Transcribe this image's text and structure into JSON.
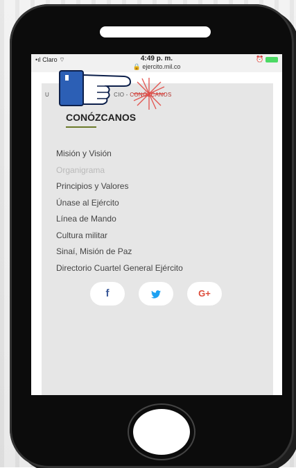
{
  "status_bar": {
    "carrier": "Claro",
    "time": "4:49 p. m.",
    "url": "ejercito.mil.co"
  },
  "breadcrumb": {
    "prefix": "U",
    "middle": "CIO",
    "separator": " - ",
    "current": "CONÓZCANOS"
  },
  "section": {
    "title": "CONÓZCANOS"
  },
  "menu": [
    {
      "label": "Misión y Visión",
      "active": true
    },
    {
      "label": "Organigrama",
      "active": false
    },
    {
      "label": "Principios y Valores",
      "active": true
    },
    {
      "label": "Únase al Ejército",
      "active": true
    },
    {
      "label": "Línea de Mando",
      "active": true
    },
    {
      "label": "Cultura militar",
      "active": true
    },
    {
      "label": "Sinaí, Misión de Paz",
      "active": true
    },
    {
      "label": "Directorio Cuartel General Ejército",
      "active": true
    }
  ],
  "social": {
    "facebook": "f",
    "twitter": "🐦",
    "googleplus": "G+"
  },
  "colors": {
    "accent_red": "#b2322c",
    "underline_olive": "#6b7a2a",
    "facebook": "#3b5998",
    "twitter": "#1da1f2",
    "googleplus": "#dd4b39"
  }
}
